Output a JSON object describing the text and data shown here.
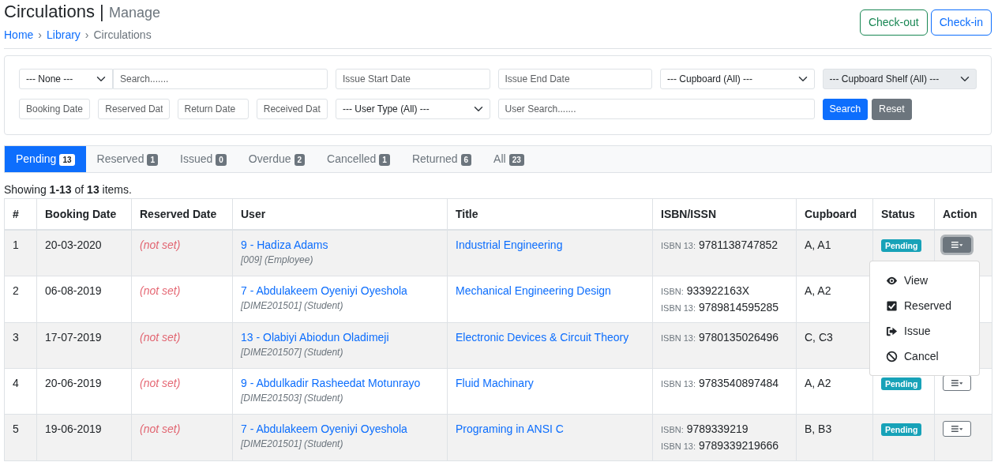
{
  "header": {
    "title": "Circulations",
    "separator": "|",
    "subtitle": "Manage"
  },
  "breadcrumb": [
    {
      "label": "Home",
      "link": true
    },
    {
      "label": "Library",
      "link": true
    },
    {
      "label": "Circulations",
      "link": false
    }
  ],
  "breadcrumb_separator": "›",
  "header_buttons": [
    {
      "label": "Check-out",
      "kind": "success"
    },
    {
      "label": "Check-in",
      "kind": "primary"
    }
  ],
  "filters": {
    "row_1": [
      {
        "kind": "select",
        "value": "--- None ---",
        "disabled": false
      },
      {
        "kind": "input",
        "placeholder": "Search.......",
        "disabled": false
      },
      {
        "kind": "input",
        "placeholder": "Issue Start Date",
        "disabled": false
      },
      {
        "kind": "input",
        "placeholder": "Issue End Date",
        "disabled": false
      },
      {
        "kind": "select",
        "value": "--- Cupboard (All) ---",
        "disabled": false
      },
      {
        "kind": "select",
        "value": "--- Cupboard Shelf (All) ---",
        "disabled": true
      }
    ],
    "date_fields": [
      {
        "placeholder": "Booking Date"
      },
      {
        "placeholder": "Reserved Dat"
      },
      {
        "placeholder": "Return Date"
      },
      {
        "placeholder": "Received Dat"
      }
    ],
    "user_type": {
      "value": "--- User Type (All) ---"
    },
    "user_search": {
      "placeholder": "User Search......."
    },
    "buttons": [
      {
        "label": "Search",
        "kind": "primary"
      },
      {
        "label": "Reset",
        "kind": "secondary"
      }
    ]
  },
  "tabs": [
    {
      "label": "Pending",
      "count": "13",
      "selected": true
    },
    {
      "label": "Reserved",
      "count": "1",
      "selected": false
    },
    {
      "label": "Issued",
      "count": "0",
      "selected": false
    },
    {
      "label": "Overdue",
      "count": "2",
      "selected": false
    },
    {
      "label": "Cancelled",
      "count": "1",
      "selected": false
    },
    {
      "label": "Returned",
      "count": "6",
      "selected": false
    },
    {
      "label": "All",
      "count": "23",
      "selected": false
    }
  ],
  "summary": "Showing **1-13** of **13** items.",
  "table": {
    "columns": [
      "#",
      "Booking Date",
      "Reserved Date",
      "User",
      "Title",
      "ISBN/ISSN",
      "Cupboard",
      "Status",
      "Action"
    ],
    "rows": [
      {
        "number": "1",
        "booking_date": "20-03-2020",
        "reserved_date": "(not set)",
        "user": "9 - Hadiza Adams",
        "user_info": "[009] (Employee)",
        "title": "Industrial Engineering",
        "isbn": [
          {
            "label": "ISBN 13:",
            "value": "9781138747852"
          }
        ],
        "cupboard": "A, A1",
        "status": "Pending",
        "menu_open": true
      },
      {
        "number": "2",
        "booking_date": "06-08-2019",
        "reserved_date": "(not set)",
        "user": "7 - Abdulakeem Oyeniyi Oyeshola",
        "user_info": "[DIME201501] (Student)",
        "title": "Mechanical Engineering Design",
        "isbn": [
          {
            "label": "ISBN:",
            "value": "933922163X"
          },
          {
            "label": "ISBN 13:",
            "value": "9789814595285"
          }
        ],
        "cupboard": "A, A2"
      },
      {
        "number": "3",
        "booking_date": "17-07-2019",
        "reserved_date": "(not set)",
        "user": "13 - Olabiyi Abiodun Oladimeji",
        "user_info": "[DIME201507] (Student)",
        "title": "Electronic Devices & Circuit Theory",
        "isbn": [
          {
            "label": "ISBN 13:",
            "value": "9780135026496"
          }
        ],
        "cupboard": "C, C3"
      },
      {
        "number": "4",
        "booking_date": "20-06-2019",
        "reserved_date": "(not set)",
        "user": "9 - Abdulkadir Rasheedat Motunrayo",
        "user_info": "[DIME201503] (Student)",
        "title": "Fluid Machinary",
        "isbn": [
          {
            "label": "ISBN 13:",
            "value": "9783540897484"
          }
        ],
        "cupboard": "A, A2",
        "status": "Pending",
        "menu_open": false
      },
      {
        "number": "5",
        "booking_date": "19-06-2019",
        "reserved_date": "(not set)",
        "user": "7 - Abdulakeem Oyeniyi Oyeshola",
        "user_info": "[DIME201501] (Student)",
        "title": "Programing in ANSI C",
        "isbn": [
          {
            "label": "ISBN:",
            "value": "9789339219"
          },
          {
            "label": "ISBN 13:",
            "value": "9789339219666"
          }
        ],
        "cupboard": "B, B3",
        "status": "Pending",
        "menu_open": false
      }
    ]
  },
  "action_menu": [
    {
      "label": "View",
      "kind": "view"
    },
    {
      "label": "Reserved",
      "kind": "reserve"
    },
    {
      "label": "Issue",
      "kind": "issue"
    },
    {
      "label": "Cancel",
      "kind": "cancel"
    }
  ]
}
